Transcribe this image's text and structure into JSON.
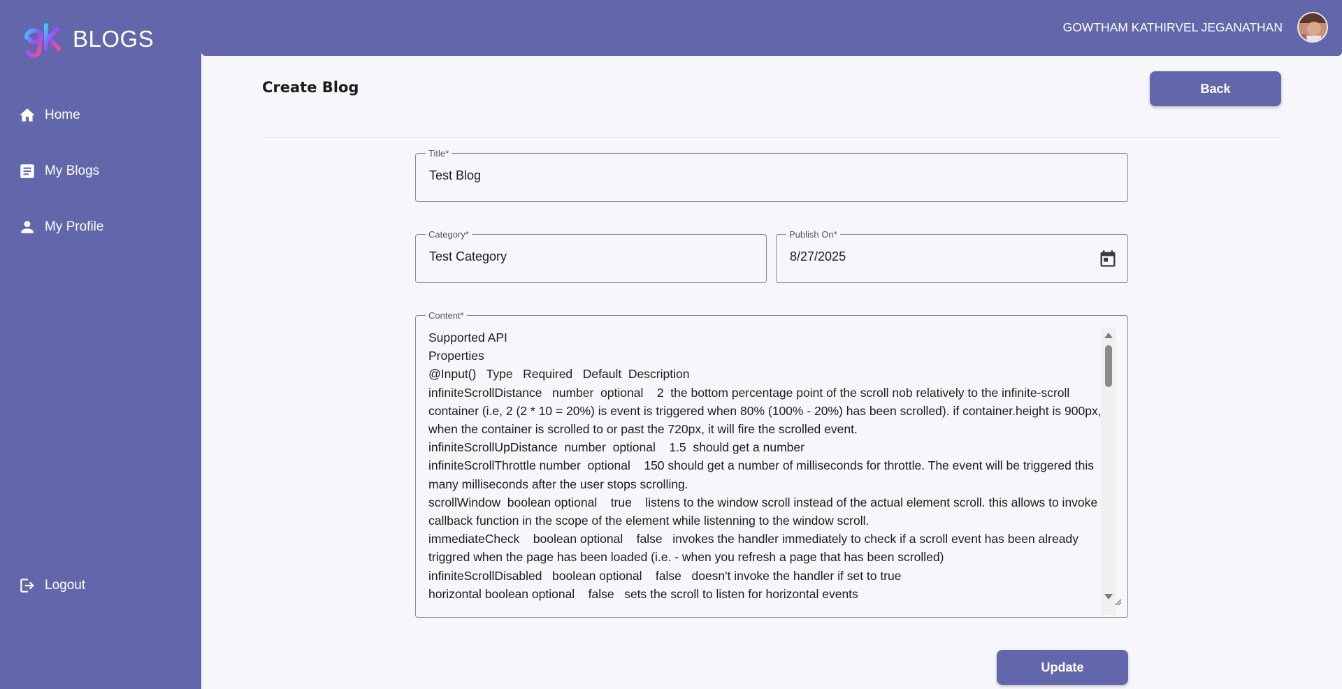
{
  "sidebar": {
    "brand": "BLOGS",
    "items": [
      {
        "label": "Home",
        "icon": "home-icon"
      },
      {
        "label": "My Blogs",
        "icon": "article-icon"
      },
      {
        "label": "My Profile",
        "icon": "person-icon"
      }
    ],
    "logout_label": "Logout"
  },
  "header": {
    "user_name": "GOWTHAM KATHIRVEL JEGANATHAN"
  },
  "page": {
    "title": "Create Blog",
    "back_label": "Back",
    "update_label": "Update"
  },
  "form": {
    "title_label": "Title*",
    "title_value": "Test Blog",
    "category_label": "Category*",
    "category_value": "Test Category",
    "publish_label": "Publish On*",
    "publish_value": "8/27/2025",
    "content_label": "Content*",
    "content_value": "Supported API\nProperties\n@Input()   Type   Required   Default  Description\ninfiniteScrollDistance   number  optional    2  the bottom percentage point of the scroll nob relatively to the infinite-scroll container (i.e, 2 (2 * 10 = 20%) is event is triggered when 80% (100% - 20%) has been scrolled). if container.height is 900px, when the container is scrolled to or past the 720px, it will fire the scrolled event.\ninfiniteScrollUpDistance  number  optional    1.5  should get a number\ninfiniteScrollThrottle number  optional    150 should get a number of milliseconds for throttle. The event will be triggered this many milliseconds after the user stops scrolling.\nscrollWindow  boolean optional    true    listens to the window scroll instead of the actual element scroll. this allows to invoke a callback function in the scope of the element while listenning to the window scroll.\nimmediateCheck    boolean optional    false   invokes the handler immediately to check if a scroll event has been already triggred when the page has been loaded (i.e. - when you refresh a page that has been scrolled)\ninfiniteScrollDisabled   boolean optional    false   doesn't invoke the handler if set to true\nhorizontal boolean optional    false   sets the scroll to listen for horizontal events"
  },
  "colors": {
    "primary": "#6267ab",
    "background": "#f7f7fb"
  }
}
